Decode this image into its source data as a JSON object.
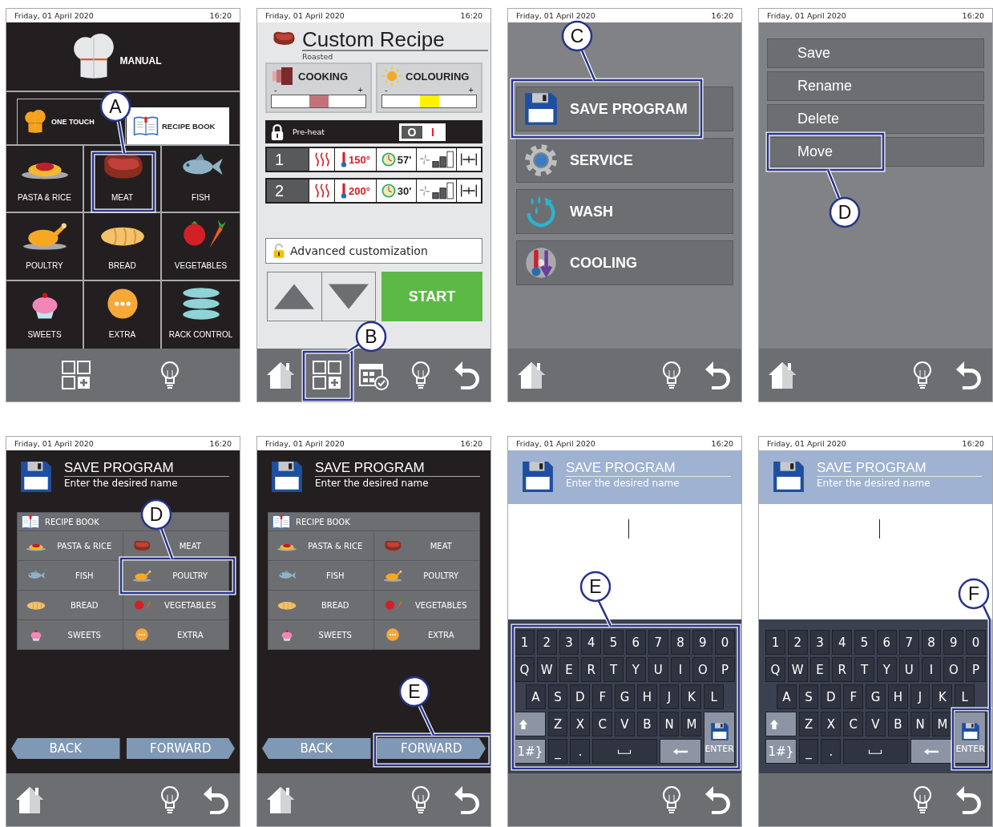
{
  "screens": [
    {
      "kind": "manual",
      "status": {
        "date": "Friday, 01 April 2020",
        "time": "16:20"
      },
      "title": "MANUAL",
      "tabs": [
        {
          "label": "ONE TOUCH",
          "selected": false
        },
        {
          "label": "RECIPE BOOK",
          "selected": true
        }
      ],
      "categories": [
        {
          "label": "PASTA & RICE"
        },
        {
          "label": "MEAT"
        },
        {
          "label": "FISH"
        },
        {
          "label": "POULTRY"
        },
        {
          "label": "BREAD"
        },
        {
          "label": "VEGETABLES"
        },
        {
          "label": "SWEETS"
        },
        {
          "label": "EXTRA"
        },
        {
          "label": "RACK CONTROL"
        }
      ],
      "callout": {
        "label": "A"
      }
    },
    {
      "kind": "recipe",
      "status": {
        "date": "Friday, 01 April 2020",
        "time": "16:20"
      },
      "title": "Custom Recipe",
      "subtitle": "Roasted",
      "sliders": [
        {
          "label": "COOKING",
          "minus": "-",
          "plus": "+",
          "level": 0.5
        },
        {
          "label": "COLOURING",
          "minus": "-",
          "plus": "+",
          "level": 0.5
        }
      ],
      "preheat": {
        "label": "Pre-heat",
        "off_label": "O",
        "on_label": "I",
        "on": false
      },
      "phases": [
        {
          "number": "1",
          "temperature": "150°",
          "time": "57'"
        },
        {
          "number": "2",
          "temperature": "200°",
          "time": "30'"
        }
      ],
      "advanced": "Advanced customization",
      "start": "START",
      "callout": {
        "label": "B"
      }
    },
    {
      "kind": "menu",
      "status": {
        "date": "Friday, 01 April 2020",
        "time": "16:20"
      },
      "items": [
        {
          "label": "SAVE PROGRAM"
        },
        {
          "label": "SERVICE"
        },
        {
          "label": "WASH"
        },
        {
          "label": "COOLING"
        }
      ],
      "callout": {
        "label": "C"
      }
    },
    {
      "kind": "actions",
      "status": {
        "date": "Friday, 01 April 2020",
        "time": "16:20"
      },
      "items": [
        {
          "label": "Save"
        },
        {
          "label": "Rename"
        },
        {
          "label": "Delete"
        },
        {
          "label": "Move"
        }
      ],
      "callout": {
        "label": "D"
      }
    },
    {
      "kind": "save_category",
      "status": {
        "date": "Friday, 01 April 2020",
        "time": "16:20"
      },
      "title": "SAVE PROGRAM",
      "subtitle": "Enter the desired name",
      "book_title": "RECIPE BOOK",
      "categories": [
        {
          "label": "PASTA & RICE"
        },
        {
          "label": "MEAT"
        },
        {
          "label": "FISH"
        },
        {
          "label": "POULTRY"
        },
        {
          "label": "BREAD"
        },
        {
          "label": "VEGETABLES"
        },
        {
          "label": "SWEETS"
        },
        {
          "label": "EXTRA"
        }
      ],
      "back": "BACK",
      "forward": "FORWARD",
      "callout": {
        "label": "D"
      }
    },
    {
      "kind": "save_category",
      "status": {
        "date": "Friday, 01 April 2020",
        "time": "16:20"
      },
      "title": "SAVE PROGRAM",
      "subtitle": "Enter the desired name",
      "book_title": "RECIPE BOOK",
      "categories": [
        {
          "label": "PASTA & RICE"
        },
        {
          "label": "MEAT"
        },
        {
          "label": "FISH"
        },
        {
          "label": "POULTRY"
        },
        {
          "label": "BREAD"
        },
        {
          "label": "VEGETABLES"
        },
        {
          "label": "SWEETS"
        },
        {
          "label": "EXTRA"
        }
      ],
      "back": "BACK",
      "forward": "FORWARD",
      "callout": {
        "label": "E"
      }
    },
    {
      "kind": "save_name",
      "status": {
        "date": "Friday, 01 April 2020",
        "time": "16:20"
      },
      "title": "SAVE PROGRAM",
      "subtitle": "Enter the desired name",
      "keys": [
        [
          "1",
          "2",
          "3",
          "4",
          "5",
          "6",
          "7",
          "8",
          "9",
          "0"
        ],
        [
          "Q",
          "W",
          "E",
          "R",
          "T",
          "Y",
          "U",
          "I",
          "O",
          "P"
        ],
        [
          "A",
          "S",
          "D",
          "F",
          "G",
          "H",
          "J",
          "K",
          "L"
        ],
        [
          "Z",
          "X",
          "C",
          "V",
          "B",
          "N",
          "M"
        ]
      ],
      "symbols_key": "1#}",
      "underscore_key": "_",
      "dot_key": ".",
      "enter_key": "ENTER",
      "callout": {
        "label": "E"
      }
    },
    {
      "kind": "save_name",
      "status": {
        "date": "Friday, 01 April 2020",
        "time": "16:20"
      },
      "title": "SAVE PROGRAM",
      "subtitle": "Enter the desired name",
      "keys": [
        [
          "1",
          "2",
          "3",
          "4",
          "5",
          "6",
          "7",
          "8",
          "9",
          "0"
        ],
        [
          "Q",
          "W",
          "E",
          "R",
          "T",
          "Y",
          "U",
          "I",
          "O",
          "P"
        ],
        [
          "A",
          "S",
          "D",
          "F",
          "G",
          "H",
          "J",
          "K",
          "L"
        ],
        [
          "Z",
          "X",
          "C",
          "V",
          "B",
          "N",
          "M"
        ]
      ],
      "symbols_key": "1#}",
      "underscore_key": "_",
      "dot_key": ".",
      "enter_key": "ENTER",
      "callout": {
        "label": "F"
      }
    }
  ]
}
